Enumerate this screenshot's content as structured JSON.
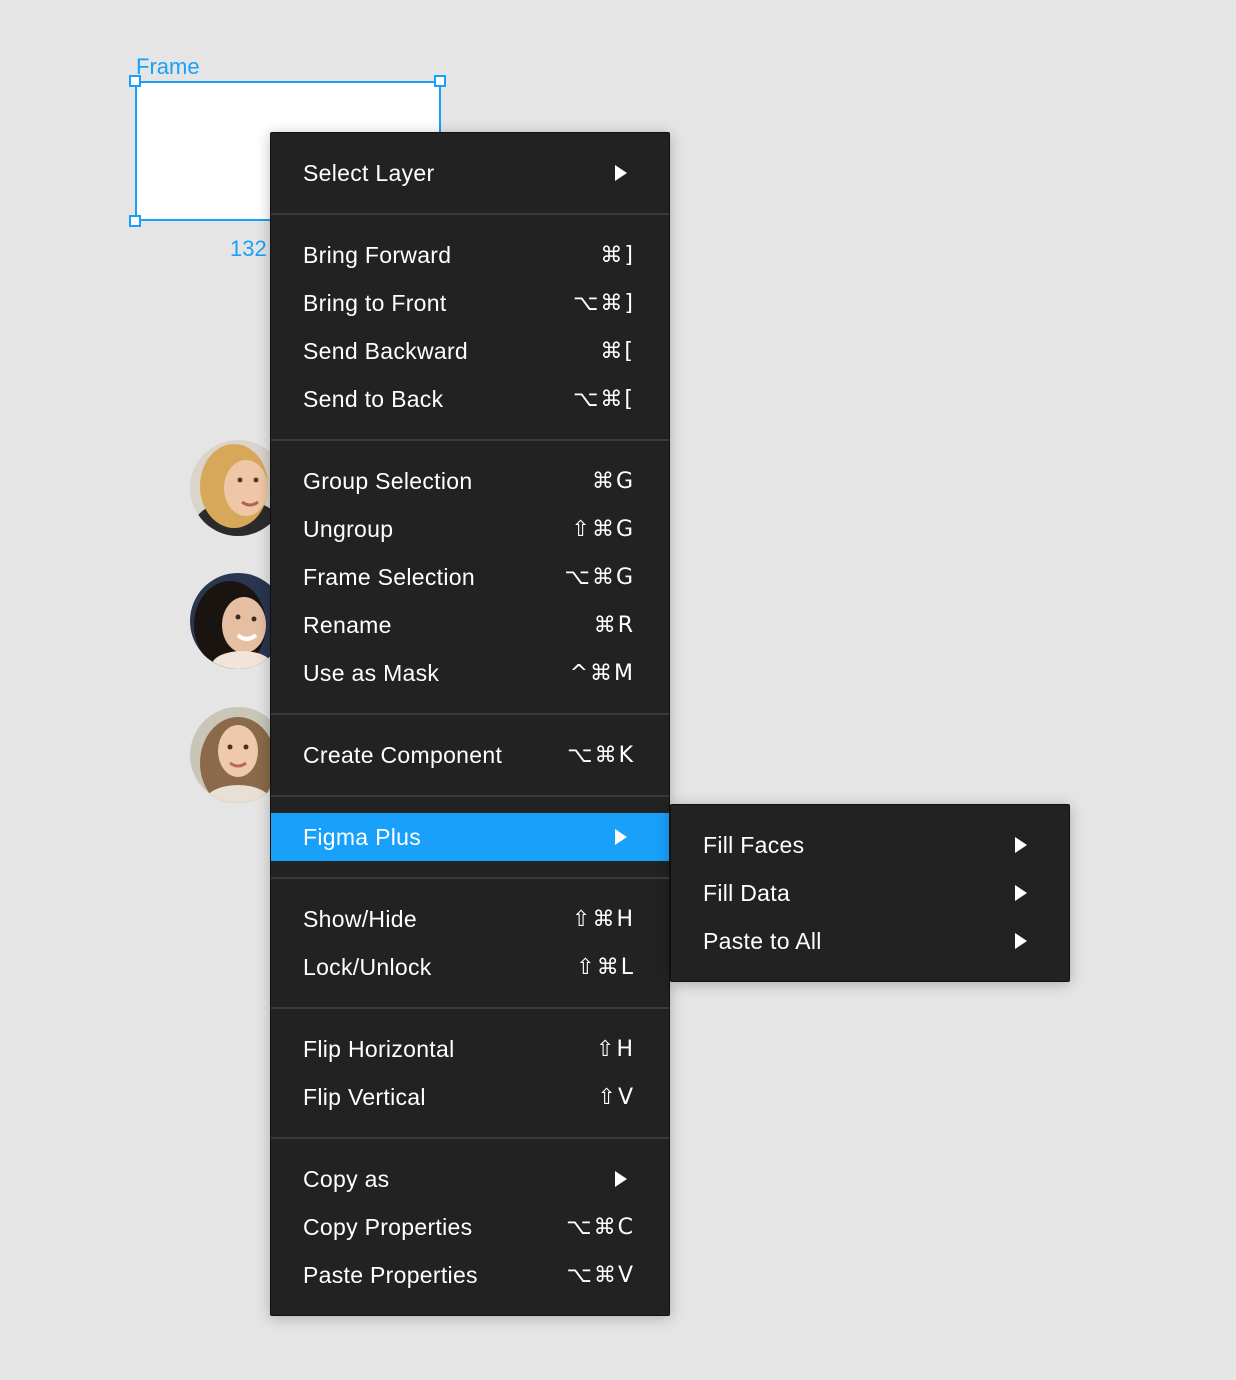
{
  "canvas": {
    "frame_label": "Frame",
    "frame_size": "132"
  },
  "menu": {
    "groups": [
      [
        {
          "label": "Select Layer",
          "shortcut": "",
          "submenu": true
        }
      ],
      [
        {
          "label": "Bring Forward",
          "shortcut": "⌘]"
        },
        {
          "label": "Bring to Front",
          "shortcut": "⌥⌘]"
        },
        {
          "label": "Send Backward",
          "shortcut": "⌘["
        },
        {
          "label": "Send to Back",
          "shortcut": "⌥⌘["
        }
      ],
      [
        {
          "label": "Group Selection",
          "shortcut": "⌘G"
        },
        {
          "label": "Ungroup",
          "shortcut": "⇧⌘G"
        },
        {
          "label": "Frame Selection",
          "shortcut": "⌥⌘G"
        },
        {
          "label": "Rename",
          "shortcut": "⌘R"
        },
        {
          "label": "Use as Mask",
          "shortcut": "^⌘M"
        }
      ],
      [
        {
          "label": "Create Component",
          "shortcut": "⌥⌘K"
        }
      ],
      [
        {
          "label": "Figma Plus",
          "shortcut": "",
          "submenu": true,
          "active": true
        }
      ],
      [
        {
          "label": "Show/Hide",
          "shortcut": "⇧⌘H"
        },
        {
          "label": "Lock/Unlock",
          "shortcut": "⇧⌘L"
        }
      ],
      [
        {
          "label": "Flip Horizontal",
          "shortcut": "⇧H"
        },
        {
          "label": "Flip Vertical",
          "shortcut": "⇧V"
        }
      ],
      [
        {
          "label": "Copy as",
          "shortcut": "",
          "submenu": true
        },
        {
          "label": "Copy Properties",
          "shortcut": "⌥⌘C"
        },
        {
          "label": "Paste Properties",
          "shortcut": "⌥⌘V"
        }
      ]
    ]
  },
  "submenu": {
    "items": [
      {
        "label": "Fill Faces"
      },
      {
        "label": "Fill Data"
      },
      {
        "label": "Paste to All"
      }
    ]
  },
  "colors": {
    "accent": "#18a0fb",
    "menu_bg": "#222222",
    "canvas_bg": "#e5e5e5"
  }
}
